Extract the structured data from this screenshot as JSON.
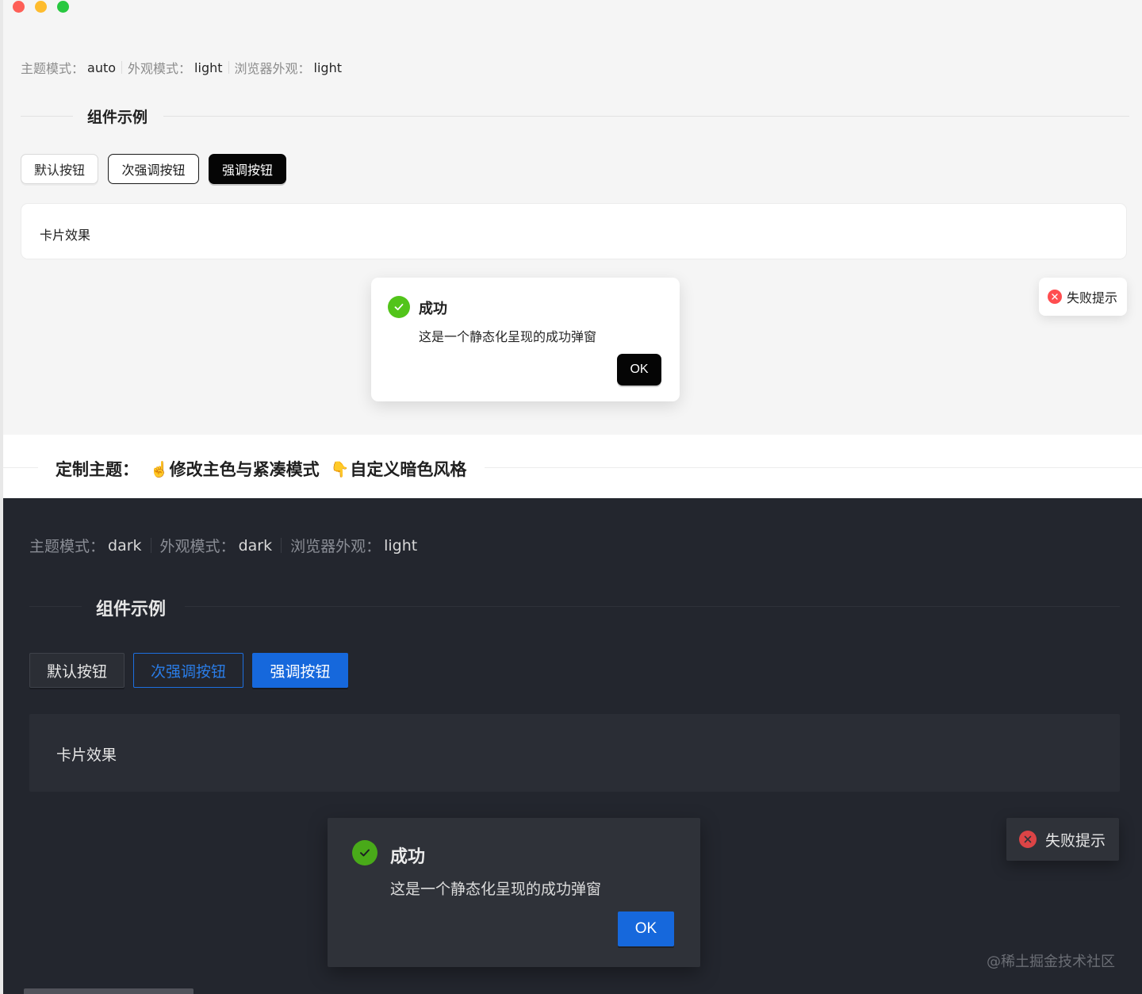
{
  "light": {
    "status": [
      {
        "label": "主题模式：",
        "value": "auto"
      },
      {
        "label": "外观模式：",
        "value": "light"
      },
      {
        "label": "浏览器外观：",
        "value": "light"
      }
    ],
    "section_title": "组件示例",
    "buttons": {
      "default": "默认按钮",
      "secondary": "次强调按钮",
      "primary": "强调按钮"
    },
    "card_text": "卡片效果",
    "modal": {
      "title": "成功",
      "body": "这是一个静态化呈现的成功弹窗",
      "ok": "OK"
    },
    "toast": "失败提示"
  },
  "heading": {
    "label": "定制主题：",
    "link1_emoji": "☝️",
    "link1": "修改主色与紧凑模式",
    "link2_emoji": "👇",
    "link2": "自定义暗色风格"
  },
  "dark": {
    "status": [
      {
        "label": "主题模式：",
        "value": "dark"
      },
      {
        "label": "外观模式：",
        "value": "dark"
      },
      {
        "label": "浏览器外观：",
        "value": "light"
      }
    ],
    "section_title": "组件示例",
    "buttons": {
      "default": "默认按钮",
      "secondary": "次强调按钮",
      "primary": "强调按钮"
    },
    "card_text": "卡片效果",
    "modal": {
      "title": "成功",
      "body": "这是一个静态化呈现的成功弹窗",
      "ok": "OK"
    },
    "toast": "失败提示"
  },
  "watermark": "@稀土掘金技术社区",
  "colors": {
    "success": "#52c41a",
    "error": "#ff4d4f",
    "dark_primary": "#1668dc",
    "dark_bg": "#23262e"
  }
}
